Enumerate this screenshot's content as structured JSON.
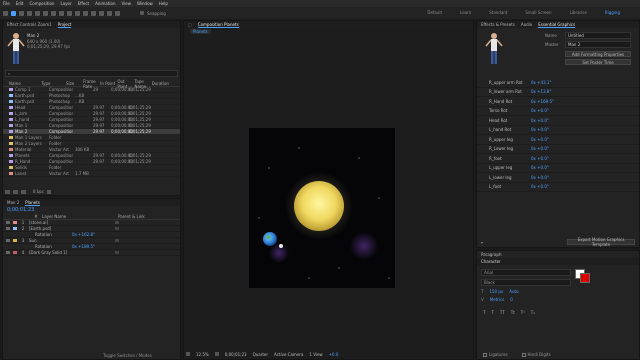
{
  "menu": [
    "File",
    "Edit",
    "Composition",
    "Layer",
    "Effect",
    "Animation",
    "View",
    "Window",
    "Help"
  ],
  "workspaces": [
    {
      "label": "Default",
      "active": false
    },
    {
      "label": "Learn",
      "active": false
    },
    {
      "label": "Standard",
      "active": false
    },
    {
      "label": "Small Screen",
      "active": false
    },
    {
      "label": "Libraries",
      "active": false
    },
    {
      "label": "Rigging",
      "active": true
    }
  ],
  "snapping": "Snapping",
  "project": {
    "tabs": [
      "Effect Controls Zoom1",
      "Project"
    ],
    "item_name": "Man 2",
    "item_info": [
      "640 x 960 (1.00)",
      "0;01;25;29, 29.97 fps"
    ],
    "search_placeholder": "",
    "columns": [
      "Name",
      "Type",
      "Size",
      "Frame Rate",
      "In Point",
      "Out Point",
      "Tape Name",
      "Duration"
    ],
    "rows": [
      {
        "name": "Comp 1",
        "type": "Composition",
        "size": "",
        "fps": "29",
        "in": "0;00;00;00",
        "dur": "0;01;25;29",
        "color": "#b8a0e8",
        "selected": false
      },
      {
        "name": "Earth.psd",
        "type": "Photoshop",
        "size": "...KB",
        "fps": "",
        "in": "",
        "dur": "",
        "color": "#8cc0ff",
        "selected": false
      },
      {
        "name": "Earth.psd",
        "type": "Photoshop",
        "size": "...KB",
        "fps": "",
        "in": "",
        "dur": "",
        "color": "#8cc0ff",
        "selected": false
      },
      {
        "name": "Head",
        "type": "Composition",
        "size": "",
        "fps": "29.97",
        "in": "0;00;00;00",
        "dur": "0;01;25;29",
        "color": "#b8a0e8",
        "selected": false
      },
      {
        "name": "L_arm",
        "type": "Composition",
        "size": "",
        "fps": "29.97",
        "in": "0;00;00;00",
        "dur": "0;01;25;29",
        "color": "#b8a0e8",
        "selected": false
      },
      {
        "name": "L_hand",
        "type": "Composition",
        "size": "",
        "fps": "29.97",
        "in": "0;00;00;00",
        "dur": "0;01;25;29",
        "color": "#b8a0e8",
        "selected": false
      },
      {
        "name": "Man 1",
        "type": "Composition",
        "size": "",
        "fps": "29.97",
        "in": "0;00;00;00",
        "dur": "0;01;25;29",
        "color": "#b8a0e8",
        "selected": false
      },
      {
        "name": "Man 2",
        "type": "Composition",
        "size": "",
        "fps": "29.97",
        "in": "0;00;00;00",
        "dur": "0;01;25;29",
        "color": "#b8a0e8",
        "selected": true
      },
      {
        "name": "Man 1 Layers",
        "type": "Folder",
        "size": "",
        "fps": "",
        "in": "",
        "dur": "",
        "color": "#e0c060",
        "selected": false
      },
      {
        "name": "Man 2 Layers",
        "type": "Folder",
        "size": "",
        "fps": "",
        "in": "",
        "dur": "",
        "color": "#e0c060",
        "selected": false
      },
      {
        "name": "Material",
        "type": "Vector Art",
        "size": "306 KB",
        "fps": "",
        "in": "",
        "dur": "",
        "color": "#e08a8a",
        "selected": false
      },
      {
        "name": "Planets",
        "type": "Composition",
        "size": "",
        "fps": "29.97",
        "in": "0;00;00;00",
        "dur": "0;01;25;29",
        "color": "#b8a0e8",
        "selected": false
      },
      {
        "name": "R_Hand",
        "type": "Composition",
        "size": "",
        "fps": "29.97",
        "in": "0;00;00;00",
        "dur": "0;01;25;29",
        "color": "#b8a0e8",
        "selected": false
      },
      {
        "name": "Solids",
        "type": "Folder",
        "size": "",
        "fps": "",
        "in": "",
        "dur": "",
        "color": "#e0c060",
        "selected": false
      },
      {
        "name": "Lanet",
        "type": "Vector Art",
        "size": "1.7 MB",
        "fps": "",
        "in": "",
        "dur": "",
        "color": "#e08a8a",
        "selected": false
      }
    ],
    "bpc": "8 bpc"
  },
  "viewer": {
    "tab": "Composition Planets",
    "sub_tab": "Planets",
    "zoom": "12.5%",
    "timecode": "0;00;01;23",
    "resolution": "Quarter",
    "camera": "Active Camera",
    "views": "1 View",
    "offset": "+0.0"
  },
  "timeline": {
    "tabs": [
      "Man 2",
      "Planets"
    ],
    "timecode": "0;00;01;23",
    "columns": [
      "#",
      "Layer Name",
      "Parent & Link"
    ],
    "layers": [
      {
        "num": "1",
        "name": "[stone.ai]",
        "value": "",
        "color": "#e08a8a"
      },
      {
        "num": "2",
        "name": "[Earth.psd]",
        "value": "",
        "color": "#8cc0ff"
      },
      {
        "num": "",
        "name": "Rotation",
        "value": "0x +162.8°",
        "color": ""
      },
      {
        "num": "3",
        "name": "Sun",
        "value": "",
        "color": "#e0b040"
      },
      {
        "num": "",
        "name": "Rotation",
        "value": "0x +189.5°",
        "color": ""
      },
      {
        "num": "4",
        "name": "[Dark Gray Solid 1]",
        "value": "",
        "color": "#c06060"
      }
    ],
    "footer": "Toggle Switches / Modes"
  },
  "right": {
    "tabs": [
      "Effects & Presets",
      "Audio",
      "Essential Graphics"
    ],
    "name_label": "Name",
    "name_value": "Untitled",
    "master_label": "Master",
    "master_value": "Man 2",
    "add_props_btn": "Add Formatting Properties",
    "set_poster_btn": "Set Poster Time",
    "eg_rows": [
      {
        "label": "R_upper arm Rot",
        "value": "0x +43.1°"
      },
      {
        "label": "R_lower arm Rot",
        "value": "0x +13.8°"
      },
      {
        "label": "R_Hand Rot",
        "value": "0x +169.5°"
      },
      {
        "label": "Torso Rot",
        "value": "0x +0.0°"
      },
      {
        "label": "Head Rot",
        "value": "0x +0.0°"
      },
      {
        "label": "L_hand Rot",
        "value": "0x +0.0°"
      },
      {
        "label": "R_upper leg",
        "value": "0x +0.0°"
      },
      {
        "label": "R_Lower leg",
        "value": "0x +0.0°"
      },
      {
        "label": "R_foot",
        "value": "0x +0.0°"
      },
      {
        "label": "L_upper leg",
        "value": "0x +0.0°"
      },
      {
        "label": "L_lower leg",
        "value": "0x +0.0°"
      },
      {
        "label": "L_foot",
        "value": "0x +0.0°"
      }
    ],
    "export_btn": "Export Motion Graphics Template",
    "paragraph_label": "Paragraph",
    "character_label": "Character",
    "font_name": "Arial",
    "font_style": "Black",
    "font_size": "150 px",
    "leading": "Auto",
    "kerning": "Metrics",
    "tracking": "0",
    "ligatures_label": "Ligatures",
    "hindi_label": "Hindi Digits"
  }
}
